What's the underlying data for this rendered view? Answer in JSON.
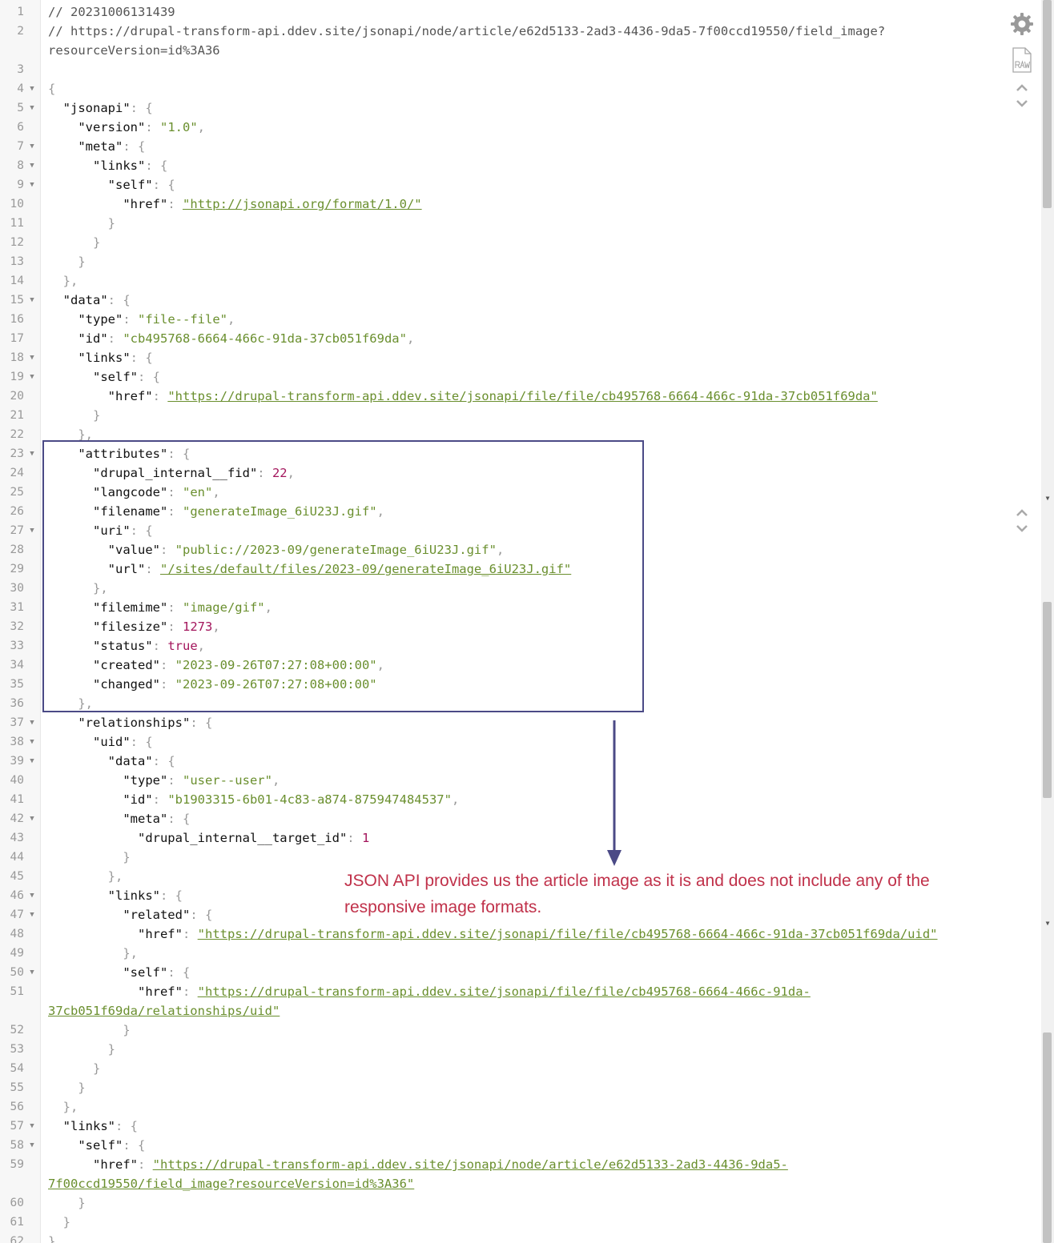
{
  "annotation": {
    "text": "JSON API provides us the article image as it is and does not include any of the responsive image formats."
  },
  "lines": [
    {
      "n": "1",
      "fold": false,
      "t": [
        [
          "c",
          "// 20231006131439"
        ]
      ]
    },
    {
      "n": "2",
      "fold": false,
      "t": [
        [
          "c",
          "// https://drupal-transform-api.ddev.site/jsonapi/node/article/e62d5133-2ad3-4436-9da5-7f00ccd19550/field_image?"
        ]
      ]
    },
    {
      "n": "",
      "fold": false,
      "t": [
        [
          "c",
          "resourceVersion=id%3A36"
        ]
      ]
    },
    {
      "n": "3",
      "fold": false,
      "t": []
    },
    {
      "n": "4",
      "fold": true,
      "t": [
        [
          "p",
          "{"
        ]
      ]
    },
    {
      "n": "5",
      "fold": true,
      "t": [
        [
          "k",
          "  \"jsonapi\""
        ],
        [
          "p",
          ": {"
        ]
      ]
    },
    {
      "n": "6",
      "fold": false,
      "t": [
        [
          "k",
          "    \"version\""
        ],
        [
          "p",
          ": "
        ],
        [
          "s",
          "\"1.0\""
        ],
        [
          "p",
          ","
        ]
      ]
    },
    {
      "n": "7",
      "fold": true,
      "t": [
        [
          "k",
          "    \"meta\""
        ],
        [
          "p",
          ": {"
        ]
      ]
    },
    {
      "n": "8",
      "fold": true,
      "t": [
        [
          "k",
          "      \"links\""
        ],
        [
          "p",
          ": {"
        ]
      ]
    },
    {
      "n": "9",
      "fold": true,
      "t": [
        [
          "k",
          "        \"self\""
        ],
        [
          "p",
          ": {"
        ]
      ]
    },
    {
      "n": "10",
      "fold": false,
      "t": [
        [
          "k",
          "          \"href\""
        ],
        [
          "p",
          ": "
        ],
        [
          "u",
          "\"http://jsonapi.org/format/1.0/\""
        ]
      ]
    },
    {
      "n": "11",
      "fold": false,
      "t": [
        [
          "p",
          "        }"
        ]
      ]
    },
    {
      "n": "12",
      "fold": false,
      "t": [
        [
          "p",
          "      }"
        ]
      ]
    },
    {
      "n": "13",
      "fold": false,
      "t": [
        [
          "p",
          "    }"
        ]
      ]
    },
    {
      "n": "14",
      "fold": false,
      "t": [
        [
          "p",
          "  },"
        ]
      ]
    },
    {
      "n": "15",
      "fold": true,
      "t": [
        [
          "k",
          "  \"data\""
        ],
        [
          "p",
          ": {"
        ]
      ]
    },
    {
      "n": "16",
      "fold": false,
      "t": [
        [
          "k",
          "    \"type\""
        ],
        [
          "p",
          ": "
        ],
        [
          "s",
          "\"file--file\""
        ],
        [
          "p",
          ","
        ]
      ]
    },
    {
      "n": "17",
      "fold": false,
      "t": [
        [
          "k",
          "    \"id\""
        ],
        [
          "p",
          ": "
        ],
        [
          "s",
          "\"cb495768-6664-466c-91da-37cb051f69da\""
        ],
        [
          "p",
          ","
        ]
      ]
    },
    {
      "n": "18",
      "fold": true,
      "t": [
        [
          "k",
          "    \"links\""
        ],
        [
          "p",
          ": {"
        ]
      ]
    },
    {
      "n": "19",
      "fold": true,
      "t": [
        [
          "k",
          "      \"self\""
        ],
        [
          "p",
          ": {"
        ]
      ]
    },
    {
      "n": "20",
      "fold": false,
      "t": [
        [
          "k",
          "        \"href\""
        ],
        [
          "p",
          ": "
        ],
        [
          "u",
          "\"https://drupal-transform-api.ddev.site/jsonapi/file/file/cb495768-6664-466c-91da-37cb051f69da\""
        ]
      ]
    },
    {
      "n": "21",
      "fold": false,
      "t": [
        [
          "p",
          "      }"
        ]
      ]
    },
    {
      "n": "22",
      "fold": false,
      "t": [
        [
          "p",
          "    },"
        ]
      ]
    },
    {
      "n": "23",
      "fold": true,
      "t": [
        [
          "k",
          "    \"attributes\""
        ],
        [
          "p",
          ": {"
        ]
      ]
    },
    {
      "n": "24",
      "fold": false,
      "t": [
        [
          "k",
          "      \"drupal_internal__fid\""
        ],
        [
          "p",
          ": "
        ],
        [
          "n",
          "22"
        ],
        [
          "p",
          ","
        ]
      ]
    },
    {
      "n": "25",
      "fold": false,
      "t": [
        [
          "k",
          "      \"langcode\""
        ],
        [
          "p",
          ": "
        ],
        [
          "s",
          "\"en\""
        ],
        [
          "p",
          ","
        ]
      ]
    },
    {
      "n": "26",
      "fold": false,
      "t": [
        [
          "k",
          "      \"filename\""
        ],
        [
          "p",
          ": "
        ],
        [
          "s",
          "\"generateImage_6iU23J.gif\""
        ],
        [
          "p",
          ","
        ]
      ]
    },
    {
      "n": "27",
      "fold": true,
      "t": [
        [
          "k",
          "      \"uri\""
        ],
        [
          "p",
          ": {"
        ]
      ]
    },
    {
      "n": "28",
      "fold": false,
      "t": [
        [
          "k",
          "        \"value\""
        ],
        [
          "p",
          ": "
        ],
        [
          "s",
          "\"public://2023-09/generateImage_6iU23J.gif\""
        ],
        [
          "p",
          ","
        ]
      ]
    },
    {
      "n": "29",
      "fold": false,
      "t": [
        [
          "k",
          "        \"url\""
        ],
        [
          "p",
          ": "
        ],
        [
          "u",
          "\"/sites/default/files/2023-09/generateImage_6iU23J.gif\""
        ]
      ]
    },
    {
      "n": "30",
      "fold": false,
      "t": [
        [
          "p",
          "      },"
        ]
      ]
    },
    {
      "n": "31",
      "fold": false,
      "t": [
        [
          "k",
          "      \"filemime\""
        ],
        [
          "p",
          ": "
        ],
        [
          "s",
          "\"image/gif\""
        ],
        [
          "p",
          ","
        ]
      ]
    },
    {
      "n": "32",
      "fold": false,
      "t": [
        [
          "k",
          "      \"filesize\""
        ],
        [
          "p",
          ": "
        ],
        [
          "n",
          "1273"
        ],
        [
          "p",
          ","
        ]
      ]
    },
    {
      "n": "33",
      "fold": false,
      "t": [
        [
          "k",
          "      \"status\""
        ],
        [
          "p",
          ": "
        ],
        [
          "n",
          "true"
        ],
        [
          "p",
          ","
        ]
      ]
    },
    {
      "n": "34",
      "fold": false,
      "t": [
        [
          "k",
          "      \"created\""
        ],
        [
          "p",
          ": "
        ],
        [
          "s",
          "\"2023-09-26T07:27:08+00:00\""
        ],
        [
          "p",
          ","
        ]
      ]
    },
    {
      "n": "35",
      "fold": false,
      "t": [
        [
          "k",
          "      \"changed\""
        ],
        [
          "p",
          ": "
        ],
        [
          "s",
          "\"2023-09-26T07:27:08+00:00\""
        ]
      ]
    },
    {
      "n": "36",
      "fold": false,
      "t": [
        [
          "p",
          "    },"
        ]
      ]
    },
    {
      "n": "37",
      "fold": true,
      "t": [
        [
          "k",
          "    \"relationships\""
        ],
        [
          "p",
          ": {"
        ]
      ]
    },
    {
      "n": "38",
      "fold": true,
      "t": [
        [
          "k",
          "      \"uid\""
        ],
        [
          "p",
          ": {"
        ]
      ]
    },
    {
      "n": "39",
      "fold": true,
      "t": [
        [
          "k",
          "        \"data\""
        ],
        [
          "p",
          ": {"
        ]
      ]
    },
    {
      "n": "40",
      "fold": false,
      "t": [
        [
          "k",
          "          \"type\""
        ],
        [
          "p",
          ": "
        ],
        [
          "s",
          "\"user--user\""
        ],
        [
          "p",
          ","
        ]
      ]
    },
    {
      "n": "41",
      "fold": false,
      "t": [
        [
          "k",
          "          \"id\""
        ],
        [
          "p",
          ": "
        ],
        [
          "s",
          "\"b1903315-6b01-4c83-a874-875947484537\""
        ],
        [
          "p",
          ","
        ]
      ]
    },
    {
      "n": "42",
      "fold": true,
      "t": [
        [
          "k",
          "          \"meta\""
        ],
        [
          "p",
          ": {"
        ]
      ]
    },
    {
      "n": "43",
      "fold": false,
      "t": [
        [
          "k",
          "            \"drupal_internal__target_id\""
        ],
        [
          "p",
          ": "
        ],
        [
          "n",
          "1"
        ]
      ]
    },
    {
      "n": "44",
      "fold": false,
      "t": [
        [
          "p",
          "          }"
        ]
      ]
    },
    {
      "n": "45",
      "fold": false,
      "t": [
        [
          "p",
          "        },"
        ]
      ]
    },
    {
      "n": "46",
      "fold": true,
      "t": [
        [
          "k",
          "        \"links\""
        ],
        [
          "p",
          ": {"
        ]
      ]
    },
    {
      "n": "47",
      "fold": true,
      "t": [
        [
          "k",
          "          \"related\""
        ],
        [
          "p",
          ": {"
        ]
      ]
    },
    {
      "n": "48",
      "fold": false,
      "t": [
        [
          "k",
          "            \"href\""
        ],
        [
          "p",
          ": "
        ],
        [
          "u",
          "\"https://drupal-transform-api.ddev.site/jsonapi/file/file/cb495768-6664-466c-91da-37cb051f69da/uid\""
        ]
      ]
    },
    {
      "n": "49",
      "fold": false,
      "t": [
        [
          "p",
          "          },"
        ]
      ]
    },
    {
      "n": "50",
      "fold": true,
      "t": [
        [
          "k",
          "          \"self\""
        ],
        [
          "p",
          ": {"
        ]
      ]
    },
    {
      "n": "51",
      "fold": false,
      "t": [
        [
          "k",
          "            \"href\""
        ],
        [
          "p",
          ": "
        ],
        [
          "u",
          "\"https://drupal-transform-api.ddev.site/jsonapi/file/file/cb495768-6664-466c-91da-"
        ]
      ]
    },
    {
      "n": "",
      "fold": false,
      "t": [
        [
          "u",
          "37cb051f69da/relationships/uid\""
        ]
      ]
    },
    {
      "n": "52",
      "fold": false,
      "t": [
        [
          "p",
          "          }"
        ]
      ]
    },
    {
      "n": "53",
      "fold": false,
      "t": [
        [
          "p",
          "        }"
        ]
      ]
    },
    {
      "n": "54",
      "fold": false,
      "t": [
        [
          "p",
          "      }"
        ]
      ]
    },
    {
      "n": "55",
      "fold": false,
      "t": [
        [
          "p",
          "    }"
        ]
      ]
    },
    {
      "n": "56",
      "fold": false,
      "t": [
        [
          "p",
          "  },"
        ]
      ]
    },
    {
      "n": "57",
      "fold": true,
      "t": [
        [
          "k",
          "  \"links\""
        ],
        [
          "p",
          ": {"
        ]
      ]
    },
    {
      "n": "58",
      "fold": true,
      "t": [
        [
          "k",
          "    \"self\""
        ],
        [
          "p",
          ": {"
        ]
      ]
    },
    {
      "n": "59",
      "fold": false,
      "t": [
        [
          "k",
          "      \"href\""
        ],
        [
          "p",
          ": "
        ],
        [
          "u",
          "\"https://drupal-transform-api.ddev.site/jsonapi/node/article/e62d5133-2ad3-4436-9da5-"
        ]
      ]
    },
    {
      "n": "",
      "fold": false,
      "t": [
        [
          "u",
          "7f00ccd19550/field_image?resourceVersion=id%3A36\""
        ]
      ]
    },
    {
      "n": "60",
      "fold": false,
      "t": [
        [
          "p",
          "    }"
        ]
      ]
    },
    {
      "n": "61",
      "fold": false,
      "t": [
        [
          "p",
          "  }"
        ]
      ]
    },
    {
      "n": "62",
      "fold": false,
      "t": [
        [
          "p",
          "}"
        ]
      ]
    }
  ]
}
